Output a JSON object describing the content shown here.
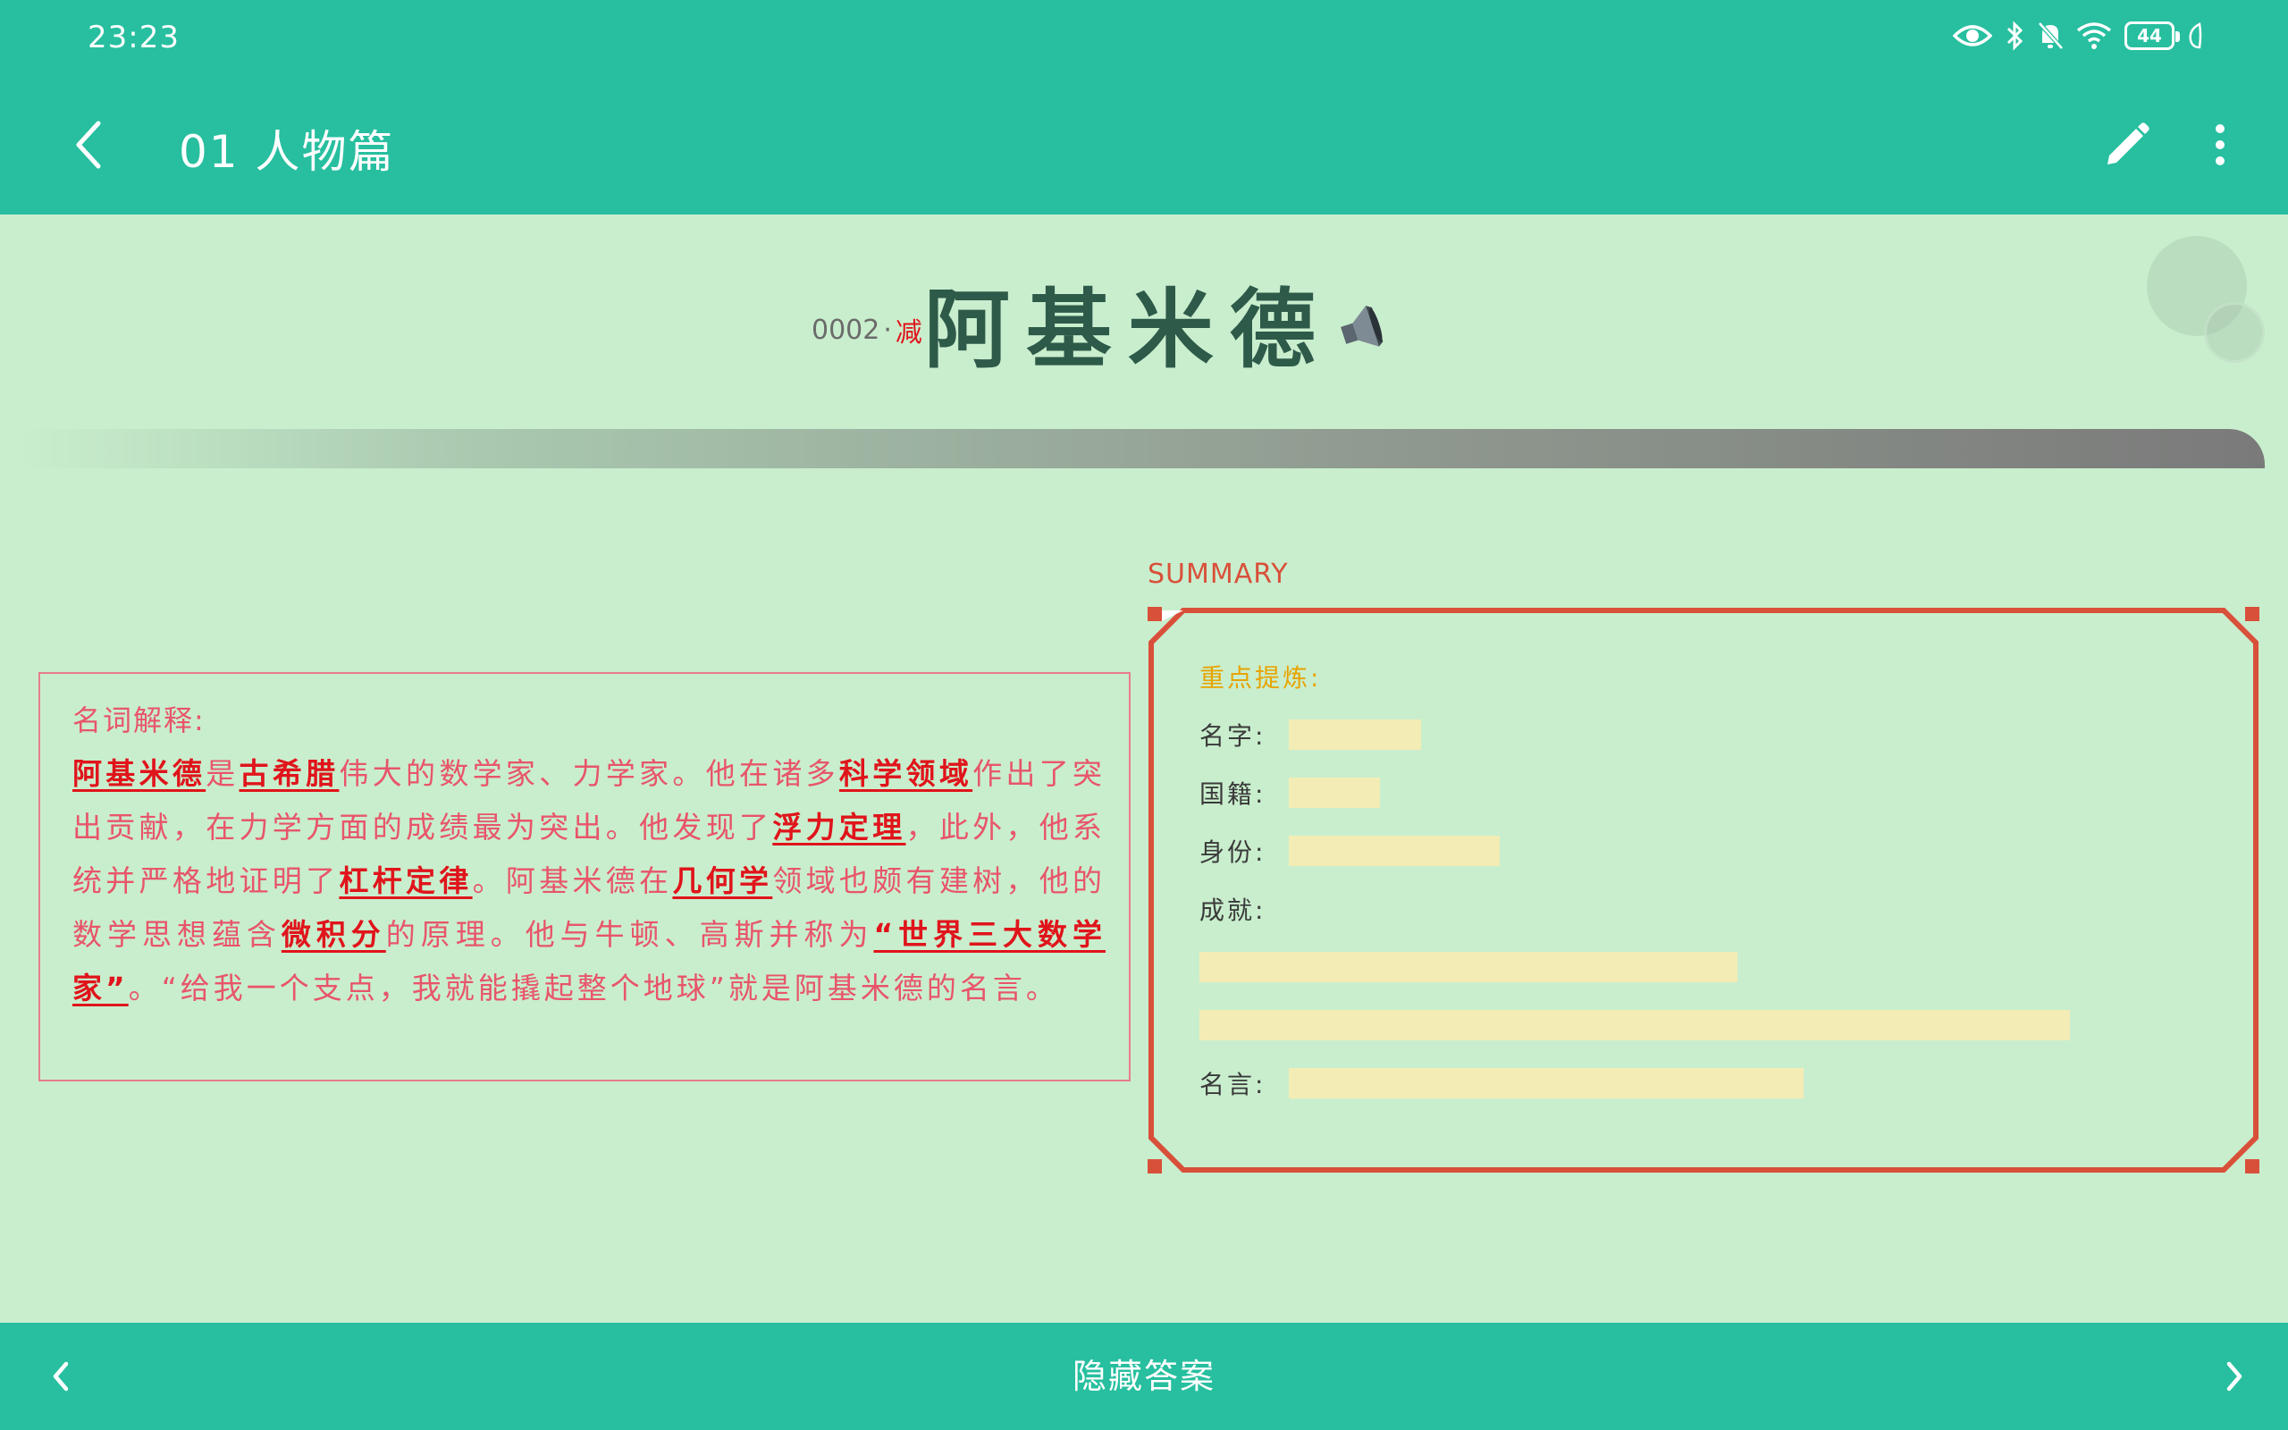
{
  "status_bar": {
    "time": "23:23",
    "battery": "44",
    "icons": [
      "eye-icon",
      "bluetooth-icon",
      "bell-off-icon",
      "wifi-icon",
      "battery-icon",
      "leaf-icon"
    ]
  },
  "toolbar": {
    "title": "01 人物篇",
    "back_icon": "chevron-left-icon",
    "edit_icon": "pencil-icon",
    "more_icon": "more-vertical-icon"
  },
  "card": {
    "number": "0002",
    "separator": "·",
    "tag": "减",
    "name": "阿基米德",
    "audio_icon": "speaker-icon"
  },
  "definition": {
    "heading": "名词解释:",
    "segments": [
      {
        "text": "阿基米德",
        "kw": true
      },
      {
        "text": "是",
        "kw": false
      },
      {
        "text": "古希腊",
        "kw": true
      },
      {
        "text": "伟大的数学家、力学家。他在诸多",
        "kw": false
      },
      {
        "text": "科学领域",
        "kw": true
      },
      {
        "text": "作出了突出贡献，在力学方面的成绩最为突出。他发现了",
        "kw": false
      },
      {
        "text": "浮力定理",
        "kw": true
      },
      {
        "text": "，此外，他系统并严格地证明了",
        "kw": false
      },
      {
        "text": "杠杆定律",
        "kw": true
      },
      {
        "text": "。阿基米德在",
        "kw": false
      },
      {
        "text": "几何学",
        "kw": true
      },
      {
        "text": "领域也颇有建树，他的数学思想蕴含",
        "kw": false
      },
      {
        "text": "微积分",
        "kw": true
      },
      {
        "text": "的原理。他与牛顿、高斯并称为",
        "kw": false
      },
      {
        "text": "“世界三大数学家”",
        "kw": true
      },
      {
        "text": "。“给我一个支点，我就能撬起整个地球”就是阿基米德的名言。",
        "kw": false
      }
    ]
  },
  "summary": {
    "label": "SUMMARY",
    "header": "重点提炼:",
    "name_label": "名字:",
    "nationality_label": "国籍:",
    "identity_label": "身份:",
    "achievement_label": "成就:",
    "quote_label": "名言:"
  },
  "bottom_bar": {
    "hide_answer": "隐藏答案",
    "prev_icon": "chevron-left-icon",
    "next_icon": "chevron-right-icon"
  },
  "colors": {
    "primary": "#27bf9f",
    "background": "#c9eecd",
    "keyword": "#e0141b",
    "text_pink": "#e8556a",
    "summary_frame": "#d9503a",
    "highlight": "#f4ecb5",
    "title_dark": "#2e5a4a"
  }
}
